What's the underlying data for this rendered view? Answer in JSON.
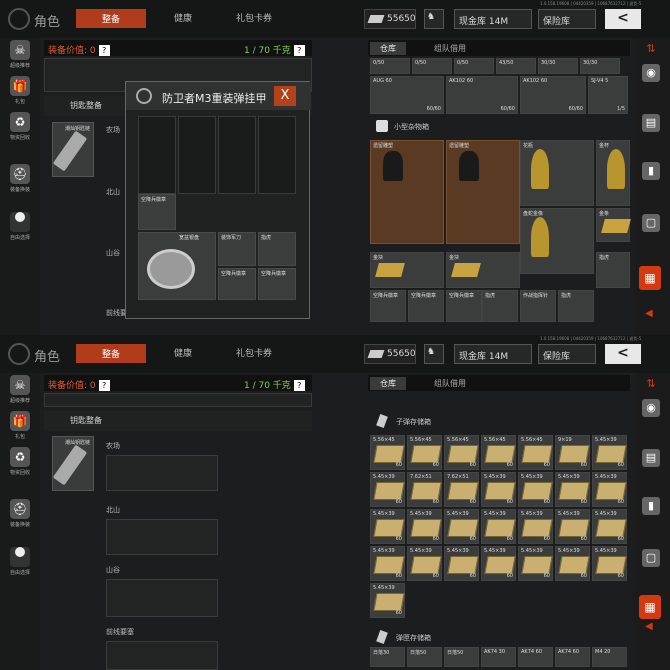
{
  "top": {
    "title": "角色",
    "tabs": [
      "整备",
      "健康",
      "礼包卡券"
    ],
    "money": "55650",
    "currency_btn": "现金库 14M",
    "safe_btn": "保险库",
    "back": "<",
    "version": "1.0.158.19608 | 04420359 | 10687632712 | 退货-5"
  },
  "left_nav": [
    "超级推荐",
    "礼包",
    "物资回收",
    "装备换装",
    "自由选择"
  ],
  "equip": {
    "value_label": "装备价值: 0",
    "weight": "1 / 70 千克",
    "q": "?"
  },
  "keys": {
    "title": "钥匙整备",
    "key_name": "潮灿钥匙链"
  },
  "sections": [
    "农场",
    "北山",
    "山谷",
    "前线要塞"
  ],
  "storage_tabs": [
    "仓库",
    "组队借用"
  ],
  "p1": {
    "top_row": [
      {
        "n": "0/50"
      },
      {
        "n": "0/50"
      },
      {
        "n": "0/50"
      },
      {
        "n": "43/50"
      },
      {
        "n": "30/30"
      },
      {
        "n": "30/30"
      }
    ],
    "weap_row": [
      {
        "n": "AUG 60",
        "c": "60/60"
      },
      {
        "n": "AK102 60",
        "c": "60/60"
      },
      {
        "n": "AK102 60",
        "c": "60/60"
      },
      {
        "n": "SJ-V4 5",
        "c": "1/5"
      }
    ],
    "misc_title": "小型杂物箱",
    "misc_items": [
      {
        "n": "遗留雕塑"
      },
      {
        "n": "遗留雕塑"
      },
      {
        "n": "花瓶"
      },
      {
        "n": "金杯"
      },
      {
        "n": ""
      },
      {
        "n": ""
      },
      {
        "n": "盘蛇金像"
      },
      {
        "n": "金条"
      },
      {
        "n": "金块"
      },
      {
        "n": "金块"
      },
      {
        "n": ""
      },
      {
        "n": "指虎"
      },
      {
        "n": "空降兵徽章"
      },
      {
        "n": "空降兵徽章"
      },
      {
        "n": "空降兵徽章"
      },
      {
        "n": "指虎"
      },
      {
        "n": "作战指挥针"
      },
      {
        "n": "指虎"
      }
    ],
    "modal": {
      "title": "防卫者M3重装弹挂甲",
      "close": "X",
      "items": [
        {
          "n": "空降兵徽章"
        },
        {
          "n": "宽盆银盘"
        },
        {
          "n": "装饰军刀"
        },
        {
          "n": "指虎"
        },
        {
          "n": "空降兵徽章"
        },
        {
          "n": "空降兵徽章"
        }
      ]
    }
  },
  "p2": {
    "ammo_title": "子弹存储箱",
    "ammo_rows": [
      [
        {
          "n": "5.56×45",
          "c": "60"
        },
        {
          "n": "5.56×45",
          "c": "60"
        },
        {
          "n": "5.56×45",
          "c": "60"
        },
        {
          "n": "5.56×45",
          "c": "60"
        },
        {
          "n": "5.56×45",
          "c": "60"
        },
        {
          "n": "9×19",
          "c": "60"
        },
        {
          "n": "5.45×39",
          "c": "60"
        }
      ],
      [
        {
          "n": "5.45×39",
          "c": "60"
        },
        {
          "n": "7.62×51",
          "c": "60"
        },
        {
          "n": "7.62×51",
          "c": "60"
        },
        {
          "n": "5.45×39",
          "c": "60"
        },
        {
          "n": "5.45×39",
          "c": "60"
        },
        {
          "n": "5.45×39",
          "c": "60"
        },
        {
          "n": "5.45×39",
          "c": "60"
        }
      ],
      [
        {
          "n": "5.45×39",
          "c": "60"
        },
        {
          "n": "5.45×39",
          "c": "60"
        },
        {
          "n": "5.45×39",
          "c": "60"
        },
        {
          "n": "5.45×39",
          "c": "60"
        },
        {
          "n": "5.45×39",
          "c": "60"
        },
        {
          "n": "5.45×39",
          "c": "60"
        },
        {
          "n": "5.45×39",
          "c": "60"
        }
      ],
      [
        {
          "n": "5.45×39",
          "c": "60"
        },
        {
          "n": "5.45×39",
          "c": "60"
        },
        {
          "n": "5.45×39",
          "c": "60"
        },
        {
          "n": "5.45×39",
          "c": "60"
        },
        {
          "n": "5.45×39",
          "c": "60"
        },
        {
          "n": "5.45×39",
          "c": "60"
        },
        {
          "n": "5.45×39",
          "c": "60"
        }
      ],
      [
        {
          "n": "5.45×39",
          "c": "60"
        }
      ]
    ],
    "mag_title": "弹匣存储箱",
    "mag_row": [
      "日落30",
      "日落50",
      "日落50",
      "AK74 30",
      "AK74 60",
      "AK74 60",
      "M4 20"
    ]
  }
}
